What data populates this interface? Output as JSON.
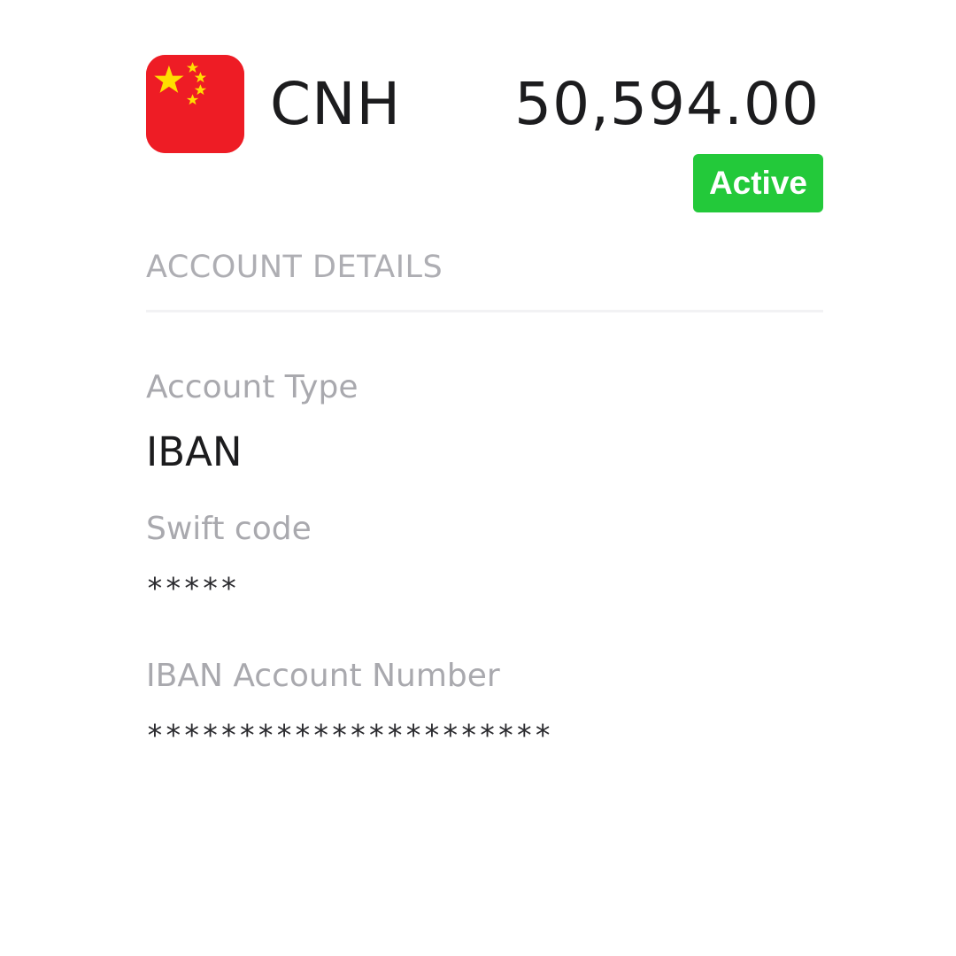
{
  "account": {
    "currency_code": "CNH",
    "balance": "50,594.00",
    "status": "Active",
    "flag_icon": "china-flag-icon",
    "colors": {
      "flag_red": "#ee1c25",
      "flag_star": "#ffde00",
      "status_green": "#23c93a",
      "label_gray": "#a9a9ae"
    }
  },
  "details": {
    "section_title": "ACCOUNT DETAILS",
    "fields": [
      {
        "label": "Account Type",
        "value": "IBAN"
      },
      {
        "label": "Swift code",
        "value": "*****"
      },
      {
        "label": "IBAN Account Number",
        "value": "**********************"
      }
    ]
  }
}
